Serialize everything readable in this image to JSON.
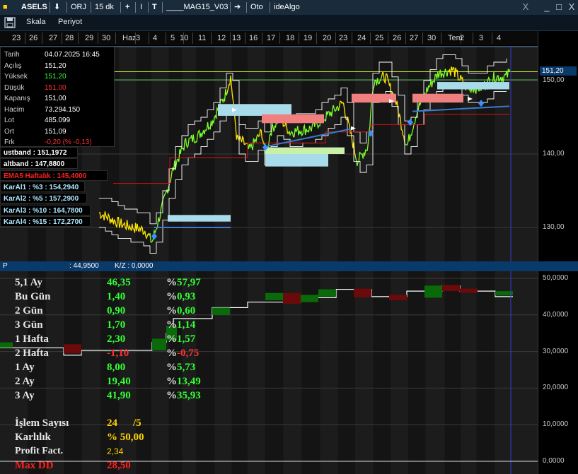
{
  "titlebar": {
    "symbol": "ASELS",
    "arrow_down": "⬇",
    "data_source": "ORJ",
    "period": "15 dk",
    "plus": "+",
    "cursor": "I",
    "t_tool": "T",
    "system_name": "____MAG15_V03",
    "arrow_right": "➔",
    "auto": "Oto",
    "app_name": "ideAlgo",
    "close_x": "X",
    "minimize": "_",
    "restore": "□",
    "close": "X"
  },
  "toolbar": {
    "scale_label": "Skala",
    "period_label": "Periyot"
  },
  "date_axis": [
    "23",
    "26",
    "27",
    "28",
    "29",
    "30",
    "Haz",
    "3",
    "4",
    "5",
    "10",
    "11",
    "12",
    "13",
    "16",
    "17",
    "18",
    "19",
    "20",
    "23",
    "24",
    "25",
    "26",
    "27",
    "30",
    "Tem",
    "2",
    "3",
    "4"
  ],
  "price_axis": {
    "labels": [
      "150,00",
      "140,00",
      "130,00"
    ],
    "current_price": "151,20"
  },
  "info": {
    "rows": [
      {
        "key": "Tarih",
        "value": "04.07.2025 16:45",
        "color": "#ffffff"
      },
      {
        "key": "Açılış",
        "value": "151,20",
        "color": "#ffffff"
      },
      {
        "key": "Yüksek",
        "value": "151,20",
        "color": "#33ff33"
      },
      {
        "key": "Düşük",
        "value": "151,00",
        "color": "#ff3333"
      },
      {
        "key": "Kapanış",
        "value": "151,00",
        "color": "#ffffff"
      },
      {
        "key": "Hacim",
        "value": "73.294.150",
        "color": "#ffffff"
      },
      {
        "key": "Lot",
        "value": "485.099",
        "color": "#ffffff"
      },
      {
        "key": "Ort",
        "value": "151,09",
        "color": "#ffffff"
      },
      {
        "key": "Frk",
        "value": "-0,20 (% -0,13)",
        "color": "#ff3333"
      }
    ]
  },
  "bands": [
    {
      "label": "ustband : 151,1972",
      "color": "#ffffff"
    },
    {
      "label": "altband : 147,8800",
      "color": "#ffffff"
    },
    {
      "label": "EMA5 Haftalık : 145,4000",
      "color": "#ff2020"
    },
    {
      "label": "KarAl1 : %3 : 154,2940",
      "color": "#aee8ff"
    },
    {
      "label": "KarAl2 : %5 : 157,2900",
      "color": "#aee8ff"
    },
    {
      "label": "KarAl3 : %10 : 164,7800",
      "color": "#aee8ff"
    },
    {
      "label": "KarAl4 : %15 : 172,2700",
      "color": "#aee8ff"
    }
  ],
  "separator": {
    "label_p": "P",
    "value1": ": 44,9500",
    "kz": "K/Z : 0,0000"
  },
  "lower_axis": {
    "labels": [
      "50,0000",
      "40,0000",
      "30,0000",
      "20,0000",
      "10,0000",
      "0,0000"
    ]
  },
  "stats": [
    {
      "label": "5,1 Ay",
      "value": "46,35",
      "pct_sign": "%",
      "pct": "57,97",
      "value_color": "#33ff33",
      "pct_color": "#33ff33"
    },
    {
      "label": "Bu Gün",
      "value": "1,40",
      "pct_sign": "%",
      "pct": "0,93",
      "value_color": "#33ff33",
      "pct_color": "#33ff33"
    },
    {
      "label": "2 Gün",
      "value": "0,90",
      "pct_sign": "%",
      "pct": "0,60",
      "value_color": "#33ff33",
      "pct_color": "#33ff33"
    },
    {
      "label": "3 Gün",
      "value": "1,70",
      "pct_sign": "%",
      "pct": "1,14",
      "value_color": "#33ff33",
      "pct_color": "#33ff33"
    },
    {
      "label": "1 Hafta",
      "value": "2,30",
      "pct_sign": "%",
      "pct": "1,57",
      "value_color": "#33ff33",
      "pct_color": "#33ff33"
    },
    {
      "label": "2 Hafta",
      "value": "-1,10",
      "pct_sign": "%",
      "pct": "-0,75",
      "value_color": "#ff3333",
      "pct_color": "#ff3333"
    },
    {
      "label": "1 Ay",
      "value": "8,00",
      "pct_sign": "%",
      "pct": "5,73",
      "value_color": "#33ff33",
      "pct_color": "#33ff33"
    },
    {
      "label": "2 Ay",
      "value": "19,40",
      "pct_sign": "%",
      "pct": "13,49",
      "value_color": "#33ff33",
      "pct_color": "#33ff33"
    },
    {
      "label": "3 Ay",
      "value": "41,90",
      "pct_sign": "%",
      "pct": "35,93",
      "value_color": "#33ff33",
      "pct_color": "#33ff33"
    }
  ],
  "summary": {
    "trades_label": "İşlem Sayısı",
    "trades_value": "24",
    "trades_sep": "/5",
    "winrate_label": "Karlılık",
    "winrate_value": "% 50,00",
    "pf_label": "Profit Fact.",
    "pf_value": "2,34",
    "maxdd_label": "Max DD",
    "maxdd_value": "28,50"
  },
  "colors": {
    "green": "#33ff33",
    "red": "#ff3333",
    "yellow": "#ffd200",
    "accent_blue": "#0a3a6a"
  }
}
